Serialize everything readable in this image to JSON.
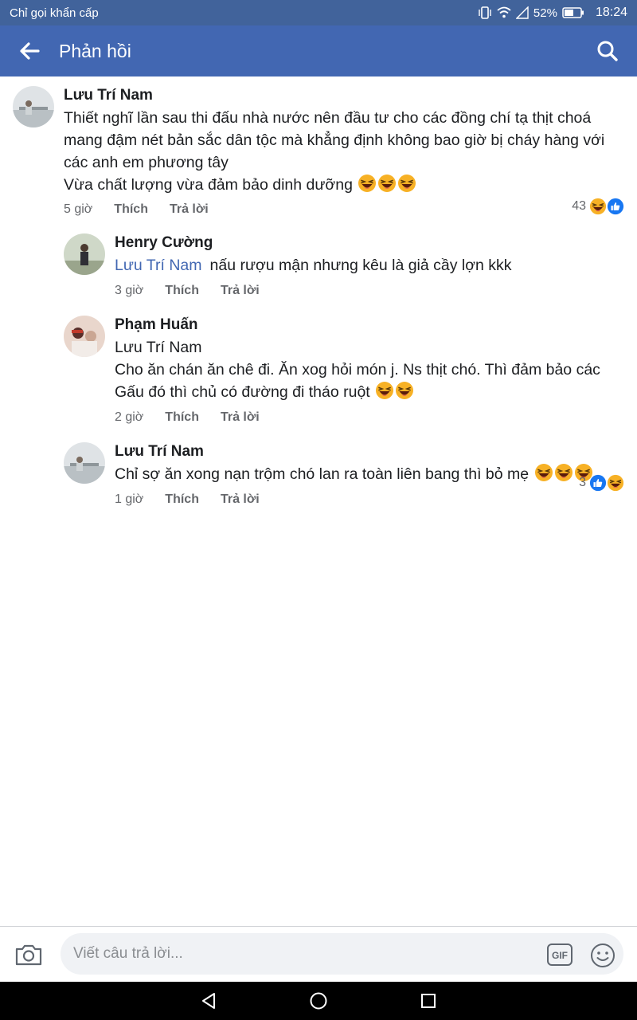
{
  "status_bar": {
    "carrier": "Chỉ gọi khẩn cấp",
    "battery": "52%",
    "time": "18:24"
  },
  "header": {
    "title": "Phản hồi"
  },
  "comments": [
    {
      "author": "Lưu Trí Nam",
      "lines": [
        "Thiết nghĩ lần sau thi đấu nhà nước nên đầu tư cho các đồng chí tạ thịt choá",
        "mang đậm nét bản sắc dân tộc mà khẳng định không bao giờ bị cháy hàng với",
        "các anh em phương tây",
        "Vừa chất lượng vừa đảm bảo dinh dưỡng"
      ],
      "time": "5 giờ",
      "like_label": "Thích",
      "reply_label": "Trả lời",
      "reaction_count": "43"
    },
    {
      "author": "Henry Cường",
      "mention": "Lưu Trí Nam",
      "text": "nấu rượu mận nhưng kêu là giả cầy lợn kkk",
      "time": "3 giờ",
      "like_label": "Thích",
      "reply_label": "Trả lời"
    },
    {
      "author": "Phạm Huấn",
      "lines": [
        "Lưu Trí Nam",
        "Cho ăn chán ăn chê đi. Ăn xog hỏi món j. Ns thịt chó. Thì đảm bảo các",
        "Gấu đó thì chủ có đường đi tháo ruột"
      ],
      "time": "2 giờ",
      "like_label": "Thích",
      "reply_label": "Trả lời"
    },
    {
      "author": "Lưu Trí Nam",
      "text": "Chỉ sợ ăn xong nạn trộm chó lan ra toàn liên bang thì bỏ mẹ",
      "time": "1 giờ",
      "like_label": "Thích",
      "reply_label": "Trả lời",
      "reaction_count": "3"
    }
  ],
  "composer": {
    "placeholder": "Viết câu trả lời..."
  },
  "icons": {
    "back": "arrow-left-icon",
    "search": "search-icon",
    "camera": "camera-icon",
    "gif": "gif-icon",
    "emoji": "smiley-icon",
    "laugh": "laughing-emoji-icon",
    "like": "like-reaction-icon",
    "nav_back": "triangle-back-icon",
    "nav_home": "circle-home-icon",
    "nav_recent": "square-recents-icon"
  },
  "colors": {
    "header": "#4267b2",
    "status": "#41639b",
    "mention": "#4267b2",
    "like": "#1877f2",
    "haha": "#f7b125"
  }
}
